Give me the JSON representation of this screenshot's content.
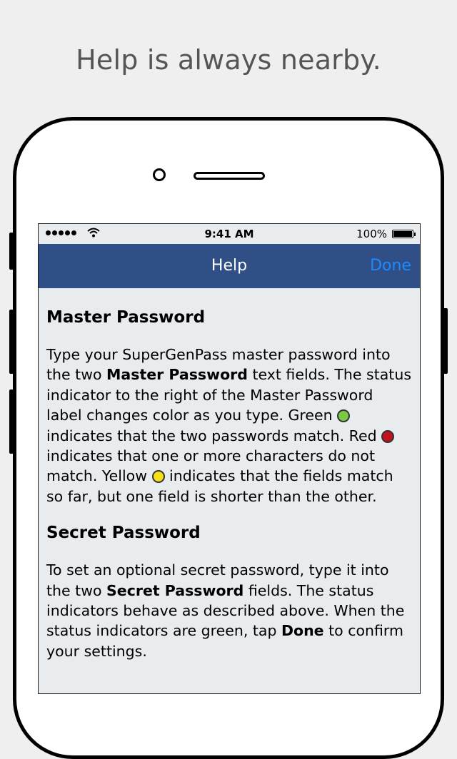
{
  "headline": "Help is always nearby.",
  "status_bar": {
    "time": "9:41 AM",
    "battery": "100%",
    "battery_level_percent": 100
  },
  "nav": {
    "title": "Help",
    "done_label": "Done"
  },
  "colors": {
    "navbar": "#2f4f86",
    "done": "#1c8bff",
    "green": "#7ac943",
    "red": "#c1121f",
    "yellow": "#f5e11a"
  },
  "sections": [
    {
      "heading": "Master Password",
      "body": {
        "t1": "Type your SuperGenPass master password into the two ",
        "b1": "Master Password",
        "t2": " text fields. The status indicator to the right of the Master Password label changes color as you type. Green ",
        "t3": " indicates that the two passwords match. Red ",
        "t4": " indicates that one or more characters do not match. Yellow ",
        "t5": " indicates that the fields match so far, but one field is shorter than the other."
      }
    },
    {
      "heading": "Secret Password",
      "body": {
        "t1": "To set an optional secret password, type it into the two ",
        "b1": "Secret Password",
        "t2": " fields. The status indicators behave as described above. When the status indicators are green, tap ",
        "b2": "Done",
        "t3": " to confirm your settings."
      }
    }
  ]
}
